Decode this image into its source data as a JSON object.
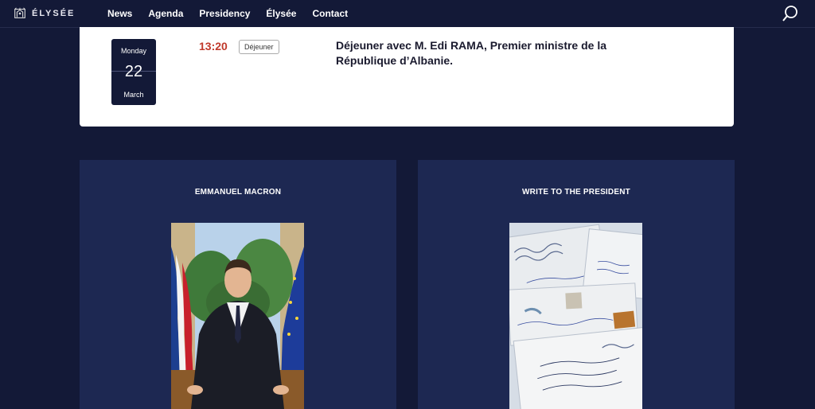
{
  "header": {
    "logo_text": "ÉLYSÉE",
    "nav": [
      "News",
      "Agenda",
      "Presidency",
      "Élysée",
      "Contact"
    ],
    "search_icon": "search-icon"
  },
  "agenda": {
    "weekday": "Monday",
    "day": "22",
    "month": "March",
    "time": "13:20",
    "tag": "Déjeuner",
    "title": "Déjeuner avec M. Edi RAMA, Premier ministre de la République d’Albanie."
  },
  "panels": {
    "left": {
      "title": "EMMANUEL MACRON"
    },
    "right": {
      "title": "WRITE TO THE PRESIDENT"
    }
  },
  "colors": {
    "background": "#131937",
    "panel": "#1d2852",
    "time_red": "#c0392b"
  }
}
